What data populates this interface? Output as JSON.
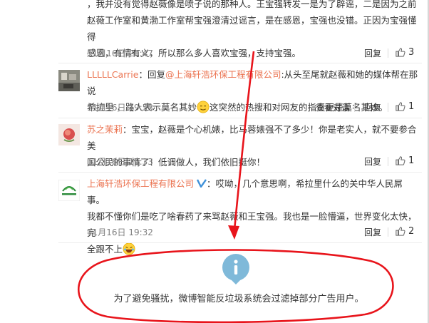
{
  "comments": [
    {
      "text_lines": [
        "，我并没有觉得赵薇像是喷子说的那种人。王宝强转发一是为了辟谣，二是因为之前",
        "赵薇工作室和黄渤工作室帮宝强澄清过谣言，是在感恩，宝强也没错。正因为宝强懂得",
        "感恩，有情有义，所以那么多人喜欢宝强，支持宝强。"
      ],
      "time": "11月16日 20:47",
      "reply_label": "回复",
      "likes": "3"
    },
    {
      "username": "LLLLLCarrie",
      "reply_prefix": "：回复",
      "mention": "@上海轩浩环保工程有限公司",
      "text_part1": ":从头至尾就赵薇和她的媒体帮在那说",
      "text_part2": "希拉里 ，路人表示莫名其妙",
      "text_part3": "这突然的热搜和对网友的指责更是莫名其妙。",
      "time": "11月16日 19:53",
      "view_conversation_label": "查看对话",
      "reply_label": "回复",
      "likes": "1"
    },
    {
      "username": "苏之茉莉",
      "text_line1": "：宝宝，赵薇是个心机婊，比马蓉婊强不了多少！你是老实人，就不要参合美",
      "text_line2": "国公民的事情了！低调做人，我们依旧挺你！",
      "time": "11月16日 19:33",
      "reply_label": "回复",
      "likes": "1"
    },
    {
      "username": "上海轩浩环保工程有限公司",
      "text_line1": "：哎呦，几个意思啊，希拉里什么的关中华人民屌事。",
      "text_line2": "我都不懂你们是吃了啥春药了来骂赵薇和王宝强。我也是一脸懵逼，世界变化太快，完",
      "text_line3": "全跟不上",
      "time": "11月16日 19:32",
      "reply_label": "回复",
      "likes": "2"
    }
  ],
  "notice": {
    "icon": "info-icon",
    "text": "为了避免骚扰，微博智能反垃圾系统会过滤掉部分广告用户。"
  },
  "annotation_color": "#e8141b",
  "accent_color": "#eb7350",
  "verified_color": "#3f91d9"
}
